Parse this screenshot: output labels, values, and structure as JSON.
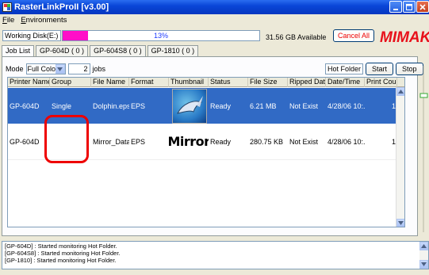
{
  "window": {
    "title": "RasterLinkProII  [v3.00]"
  },
  "menu": [
    "File",
    "Environments"
  ],
  "disk": {
    "label": "Working Disk(E:)",
    "usage_percent": 13,
    "usage_text": "13%",
    "available_text": "31.56 GB Available",
    "cancel_all_label": "Cancel All",
    "brand": "MIMAKI"
  },
  "tabs": [
    "Job List",
    "GP-604D ( 0 )",
    "GP-604S8 ( 0 )",
    "GP-1810 ( 0 )"
  ],
  "toolbar": {
    "mode_label": "Mode",
    "mode_value": "Full Color",
    "job_count": "2",
    "jobs_label": "jobs",
    "hot_folder_label": "Hot Folder",
    "start_label": "Start",
    "stop_label": "Stop"
  },
  "table": {
    "columns": [
      "Printer Name",
      "Group",
      "File Name",
      "Format",
      "Thumbnail",
      "Status",
      "File Size",
      "Ripped Data",
      "Date/Time",
      "Print Count"
    ],
    "rows": [
      {
        "printer": "GP-604D",
        "group": "Single",
        "file": "Dolphin.eps",
        "format": "EPS",
        "thumbnail": "dolphin-image",
        "status": "Ready",
        "size": "6.21 MB",
        "ripped": "Not Exist",
        "datetime": "4/28/06 10:...",
        "count": "1"
      },
      {
        "printer": "GP-604D",
        "group": "",
        "file": "Mirror_Data...",
        "format": "EPS",
        "thumbnail": "Mirror",
        "status": "Ready",
        "size": "280.75 KB",
        "ripped": "Not Exist",
        "datetime": "4/28/06 10:...",
        "count": "1"
      }
    ]
  },
  "log": [
    "[GP-604D] : Started monitoring Hot Folder.",
    "[GP-604S8] : Started monitoring Hot Folder.",
    "[GP-1810] : Started monitoring Hot Folder."
  ],
  "colors": {
    "selection": "#316ac5",
    "progress": "#ff0fc8",
    "highlight": "#e00000",
    "titlebar": "#0a46d8"
  }
}
